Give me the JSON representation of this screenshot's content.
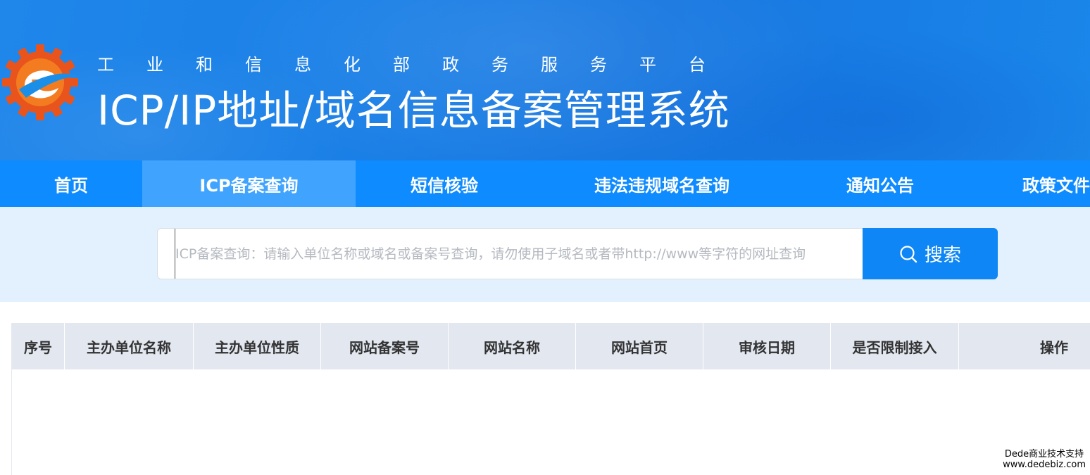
{
  "header": {
    "subtitle": "工业和信息化部政务服务平台",
    "title": "ICP/IP地址/域名信息备案管理系统",
    "logo_icon": "miit-logo-icon"
  },
  "nav": {
    "items": [
      {
        "label": "首页"
      },
      {
        "label": "ICP备案查询",
        "active": true
      },
      {
        "label": "短信核验"
      },
      {
        "label": "违法违规域名查询"
      },
      {
        "label": "通知公告"
      },
      {
        "label": "政策文件"
      }
    ]
  },
  "search": {
    "placeholder": "ICP备案查询：请输入单位名称或域名或备案号查询，请勿使用子域名或者带http://www等字符的网址查询",
    "value": "",
    "button_label": "搜索",
    "button_icon": "search-icon"
  },
  "table": {
    "columns": [
      "序号",
      "主办单位名称",
      "主办单位性质",
      "网站备案号",
      "网站名称",
      "网站首页",
      "审核日期",
      "是否限制接入",
      "操作"
    ],
    "rows": []
  },
  "watermark": {
    "line1": "Dede商业技术支持",
    "line2": "www.dedebiz.com"
  },
  "colors": {
    "banner": "#1a7fe6",
    "nav": "#0e8bff",
    "nav_active": "#40a4ff",
    "search_bg": "#e3f1fe",
    "search_button": "#0e86f5",
    "table_header": "#e2e7f0"
  }
}
